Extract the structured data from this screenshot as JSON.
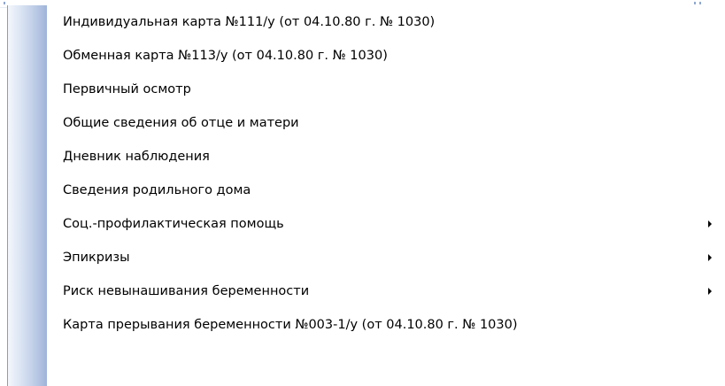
{
  "menu": {
    "items": [
      {
        "label": "Индивидуальная карта №111/у (от 04.10.80 г. № 1030)",
        "submenu": false
      },
      {
        "label": "Обменная карта №113/у (от 04.10.80 г. № 1030)",
        "submenu": false
      },
      {
        "label": "Первичный осмотр",
        "submenu": false
      },
      {
        "label": "Общие сведения об отце и матери",
        "submenu": false
      },
      {
        "label": "Дневник наблюдения",
        "submenu": false
      },
      {
        "label": "Сведения родильного дома",
        "submenu": false
      },
      {
        "label": "Соц.-профилактическая помощь",
        "submenu": true
      },
      {
        "label": "Эпикризы",
        "submenu": true
      },
      {
        "label": "Риск невынашивания беременности",
        "submenu": true
      },
      {
        "label": "Карта прерывания беременности №003-1/у (от 04.10.80 г. № 1030)",
        "submenu": false
      }
    ]
  },
  "icons": {
    "submenu_arrow": "chevron-right-icon"
  }
}
